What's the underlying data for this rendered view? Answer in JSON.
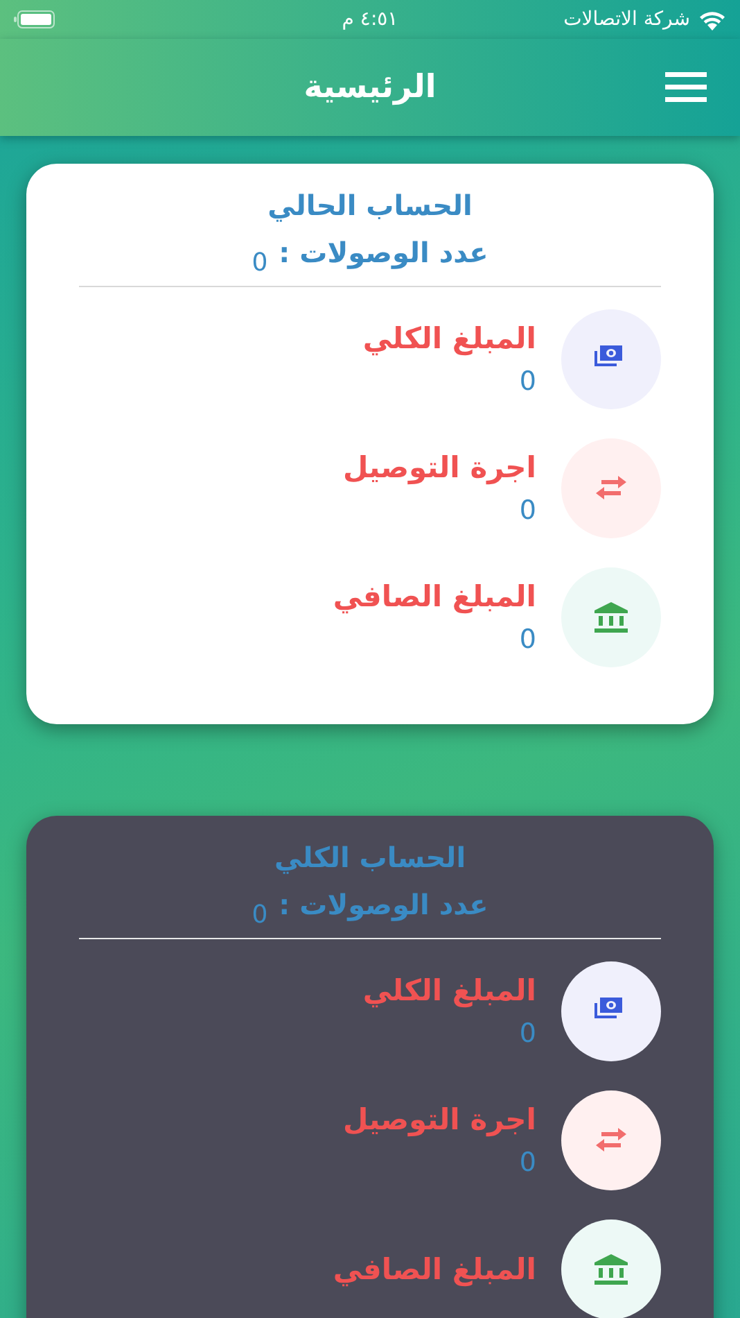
{
  "status_bar": {
    "carrier": "شركة الاتصالات",
    "time": "٤:٥١ م"
  },
  "header": {
    "title": "الرئيسية"
  },
  "cards": [
    {
      "kind": "light",
      "title": "الحساب الحالي",
      "count_label": "عدد الوصولات :",
      "count_value": "0",
      "rows": [
        {
          "kind": "money",
          "label": "المبلغ الكلي",
          "value": "0"
        },
        {
          "kind": "transfer",
          "label": "اجرة التوصيل",
          "value": "0"
        },
        {
          "kind": "bank",
          "label": "المبلغ الصافي",
          "value": "0"
        }
      ]
    },
    {
      "kind": "dark",
      "title": "الحساب الكلي",
      "count_label": "عدد الوصولات :",
      "count_value": "0",
      "rows": [
        {
          "kind": "money",
          "label": "المبلغ الكلي",
          "value": "0"
        },
        {
          "kind": "transfer",
          "label": "اجرة التوصيل",
          "value": "0"
        },
        {
          "kind": "bank",
          "label": "المبلغ الصافي"
        }
      ]
    }
  ]
}
